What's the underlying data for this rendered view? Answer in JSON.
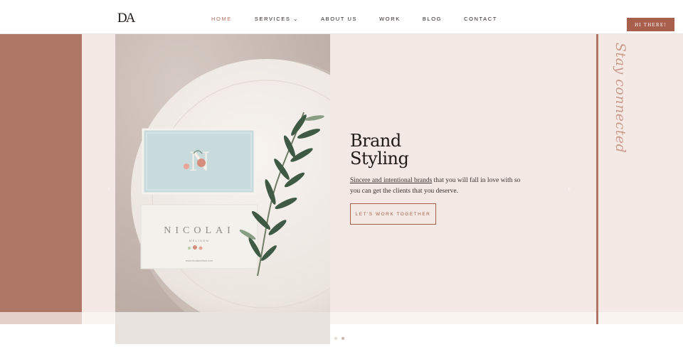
{
  "header": {
    "logo": "DA",
    "nav": [
      {
        "label": "HOME",
        "active": true
      },
      {
        "label": "SERVICES ⌄",
        "active": false
      },
      {
        "label": "ABOUT US",
        "active": false
      },
      {
        "label": "WORK",
        "active": false
      },
      {
        "label": "BLOG",
        "active": false
      },
      {
        "label": "CONTACT",
        "active": false
      }
    ],
    "cta_label": "HI THERE!"
  },
  "hero": {
    "headline_line1": "Brand",
    "headline_line2": "Styling",
    "intro_link": "Sincere and intentional brands",
    "intro_rest": " that you will fall in love with so you can get the clients that you deserve.",
    "button_label": "LET'S WORK TOGETHER",
    "script_text": "Stay connected"
  },
  "photo": {
    "card_monogram": "N",
    "card_name": "NICOLAI",
    "card_subtitle": "MELISON",
    "card_website": "www.nicolaimelison.com"
  },
  "slider": {
    "prev_icon": "chevron-left-icon",
    "next_icon": "chevron-right-icon",
    "dots": 2,
    "active_dot": 1
  },
  "colors": {
    "accent": "#a8604c",
    "band": "#ae7665",
    "hero_bg": "#f3e8e3"
  }
}
